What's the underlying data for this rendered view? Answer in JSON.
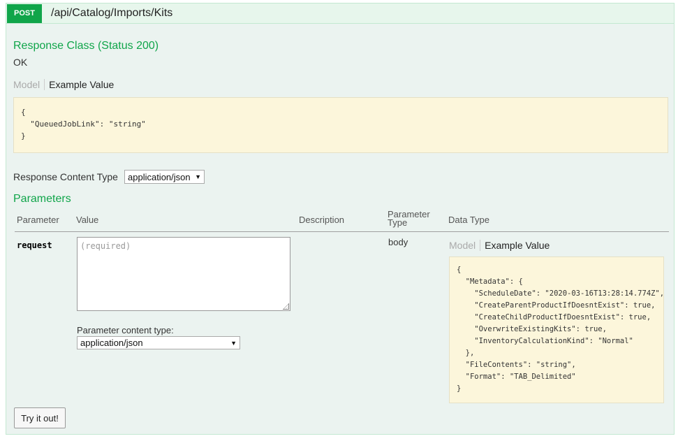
{
  "operation": {
    "method": "POST",
    "path": "/api/Catalog/Imports/Kits"
  },
  "response_class": {
    "title": "Response Class (Status 200)",
    "status_text": "OK",
    "tab_model": "Model",
    "tab_example": "Example Value",
    "example": "{\n  \"QueuedJobLink\": \"string\"\n}"
  },
  "response_content_type": {
    "label": "Response Content Type",
    "selected": "application/json"
  },
  "parameters": {
    "title": "Parameters",
    "headers": {
      "parameter": "Parameter",
      "value": "Value",
      "description": "Description",
      "parameter_type": "Parameter\nType",
      "data_type": "Data Type"
    },
    "rows": [
      {
        "name": "request",
        "value_placeholder": "(required)",
        "content_type_label": "Parameter content type:",
        "content_type_selected": "application/json",
        "param_type": "body",
        "tab_model": "Model",
        "tab_example": "Example Value",
        "example": "{\n  \"Metadata\": {\n    \"ScheduleDate\": \"2020-03-16T13:28:14.774Z\",\n    \"CreateParentProductIfDoesntExist\": true,\n    \"CreateChildProductIfDoesntExist\": true,\n    \"OverwriteExistingKits\": true,\n    \"InventoryCalculationKind\": \"Normal\"\n  },\n  \"FileContents\": \"string\",\n  \"Format\": \"TAB_Delimited\"\n}"
      }
    ]
  },
  "try_button": "Try it out!"
}
